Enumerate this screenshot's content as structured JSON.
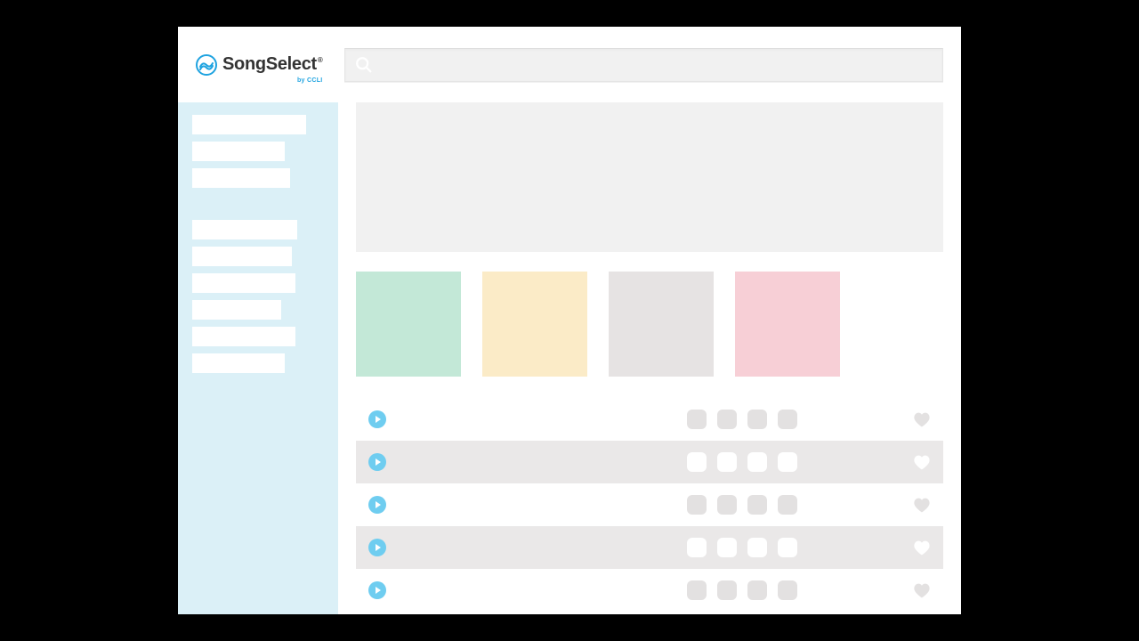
{
  "brand": {
    "name": "SongSelect",
    "registered_mark": "®",
    "byline": "by CCLI",
    "mark_color": "#1fa3e0"
  },
  "search": {
    "placeholder": ""
  },
  "sidebar": {
    "group1": [
      {
        "label": ""
      },
      {
        "label": ""
      },
      {
        "label": ""
      }
    ],
    "group2": [
      {
        "label": ""
      },
      {
        "label": ""
      },
      {
        "label": ""
      },
      {
        "label": ""
      },
      {
        "label": ""
      },
      {
        "label": ""
      }
    ]
  },
  "hero": {},
  "tiles": [
    {
      "color": "#c3e8d7"
    },
    {
      "color": "#fbebc7"
    },
    {
      "color": "#e6e3e3"
    },
    {
      "color": "#f7cfd6"
    }
  ],
  "songs": [
    {
      "title": "",
      "chips": [
        "",
        "",
        "",
        ""
      ],
      "favorited": false
    },
    {
      "title": "",
      "chips": [
        "",
        "",
        "",
        ""
      ],
      "favorited": false
    },
    {
      "title": "",
      "chips": [
        "",
        "",
        "",
        ""
      ],
      "favorited": false
    },
    {
      "title": "",
      "chips": [
        "",
        "",
        "",
        ""
      ],
      "favorited": false
    },
    {
      "title": "",
      "chips": [
        "",
        "",
        "",
        ""
      ],
      "favorited": false
    }
  ],
  "icons": {
    "search": "search-icon",
    "play": "play-icon",
    "heart": "heart-icon"
  }
}
